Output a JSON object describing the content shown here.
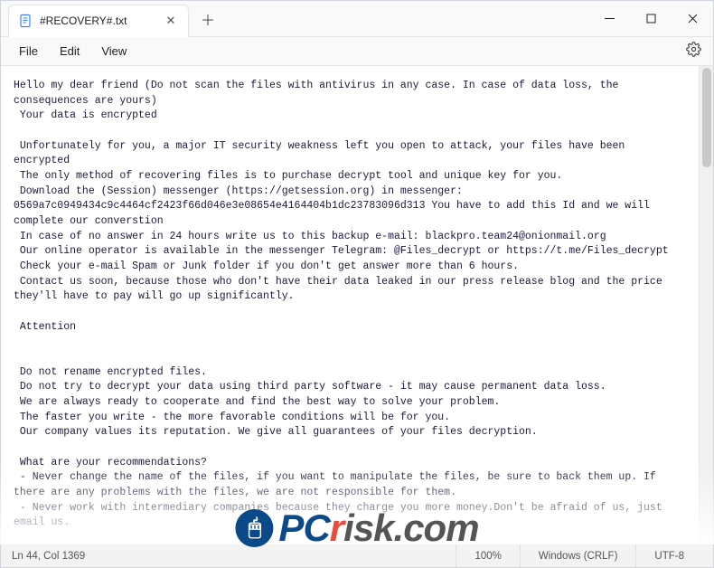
{
  "tab": {
    "title": "#RECOVERY#.txt"
  },
  "menu": {
    "file": "File",
    "edit": "Edit",
    "view": "View"
  },
  "body_text": "Hello my dear friend (Do not scan the files with antivirus in any case. In case of data loss, the consequences are yours)\n Your data is encrypted\n\n Unfortunately for you, a major IT security weakness left you open to attack, your files have been encrypted\n The only method of recovering files is to purchase decrypt tool and unique key for you.\n Download the (Session) messenger (https://getsession.org) in messenger: 0569a7c0949434c9c4464cf2423f66d046e3e08654e4164404b1dc23783096d313 You have to add this Id and we will complete our converstion\n In case of no answer in 24 hours write us to this backup e-mail: blackpro.team24@onionmail.org\n Our online operator is available in the messenger Telegram: @Files_decrypt or https://t.me/Files_decrypt\n Check your e-mail Spam or Junk folder if you don't get answer more than 6 hours.\n Contact us soon, because those who don't have their data leaked in our press release blog and the price they'll have to pay will go up significantly.\n\n Attention\n\n\n Do not rename encrypted files.\n Do not try to decrypt your data using third party software - it may cause permanent data loss.\n We are always ready to cooperate and find the best way to solve your problem.\n The faster you write - the more favorable conditions will be for you.\n Our company values its reputation. We give all guarantees of your files decryption.\n\n What are your recommendations?\n - Never change the name of the files, if you want to manipulate the files, be sure to back them up. If there are any problems with the files, we are not responsible for them.\n - Never work with intermediary companies because they charge you more money.Don't be afraid of us, just email us.\n\n\n Sensitive data on your system was DOWNLOADED.\n If you DON'T WANT your sensitive data to be PUBLISHED you have to act quickly.\n\n Data includes:\n - Employees personal data, CVs, DL, SSN.\n - Complete network map including credentials for local and remote services.\n - Private financial information including: clients data, bills, budgets, annual reports, bank statements.",
  "status": {
    "caret": "Ln 44, Col 1369",
    "zoom": "100%",
    "eol": "Windows (CRLF)",
    "encoding": "UTF-8"
  },
  "watermark": {
    "pc": "PC",
    "r": "r",
    "rest": "isk.com"
  }
}
